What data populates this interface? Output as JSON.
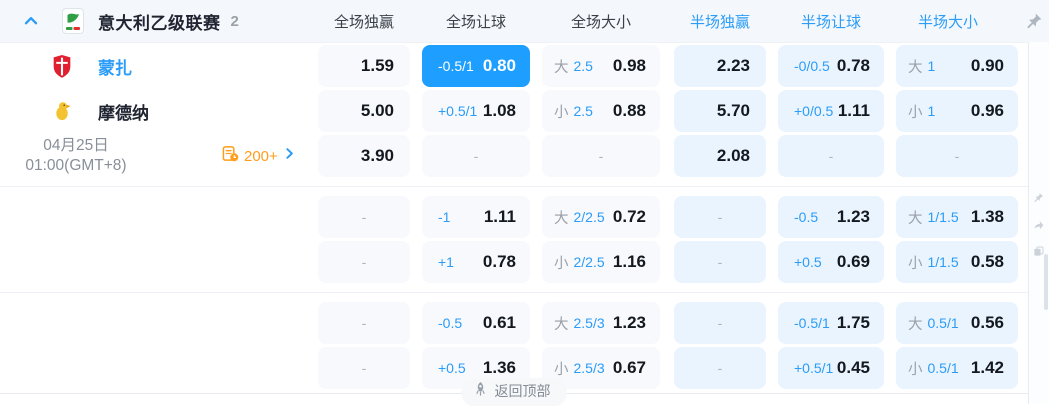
{
  "colors": {
    "accent": "#1e9fff",
    "link_blue": "#2b9cf7",
    "orange": "#ff9e1b"
  },
  "header": {
    "league": "意大利乙级联赛",
    "match_count": "2",
    "columns": [
      {
        "label": "全场独赢",
        "scope": "full"
      },
      {
        "label": "全场让球",
        "scope": "full"
      },
      {
        "label": "全场大小",
        "scope": "full"
      },
      {
        "label": "半场独赢",
        "scope": "half"
      },
      {
        "label": "半场让球",
        "scope": "half"
      },
      {
        "label": "半场大小",
        "scope": "half"
      }
    ]
  },
  "match": {
    "home": {
      "name": "蒙扎"
    },
    "away": {
      "name": "摩德纳"
    },
    "date": "04月25日",
    "time": "01:00(GMT+8)",
    "markets_count": "200+"
  },
  "groups": [
    {
      "rows": [
        {
          "left": "home",
          "cells": [
            {
              "type": "win",
              "odds": "1.59"
            },
            {
              "type": "hcp",
              "line": "-0.5/1",
              "odds": "0.80",
              "highlight": true
            },
            {
              "type": "ou",
              "side": "大",
              "line": "2.5",
              "odds": "0.98"
            },
            {
              "type": "win",
              "odds": "2.23"
            },
            {
              "type": "hcp",
              "line": "-0/0.5",
              "odds": "0.78"
            },
            {
              "type": "ou",
              "side": "大",
              "line": "1",
              "odds": "0.90"
            }
          ]
        },
        {
          "left": "away",
          "cells": [
            {
              "type": "win",
              "odds": "5.00"
            },
            {
              "type": "hcp",
              "line": "+0.5/1",
              "odds": "1.08"
            },
            {
              "type": "ou",
              "side": "小",
              "line": "2.5",
              "odds": "0.88"
            },
            {
              "type": "win",
              "odds": "5.70"
            },
            {
              "type": "hcp",
              "line": "+0/0.5",
              "odds": "1.11"
            },
            {
              "type": "ou",
              "side": "小",
              "line": "1",
              "odds": "0.96"
            }
          ]
        },
        {
          "left": "info",
          "cells": [
            {
              "type": "win",
              "odds": "3.90"
            },
            {
              "type": "dash"
            },
            {
              "type": "dash"
            },
            {
              "type": "win",
              "odds": "2.08"
            },
            {
              "type": "dash"
            },
            {
              "type": "dash"
            }
          ]
        }
      ]
    },
    {
      "rows": [
        {
          "left": "none",
          "cells": [
            {
              "type": "dash"
            },
            {
              "type": "hcp",
              "line": "-1",
              "odds": "1.11"
            },
            {
              "type": "ou",
              "side": "大",
              "line": "2/2.5",
              "odds": "0.72"
            },
            {
              "type": "dash"
            },
            {
              "type": "hcp",
              "line": "-0.5",
              "odds": "1.23"
            },
            {
              "type": "ou",
              "side": "大",
              "line": "1/1.5",
              "odds": "1.38"
            }
          ]
        },
        {
          "left": "none",
          "cells": [
            {
              "type": "dash"
            },
            {
              "type": "hcp",
              "line": "+1",
              "odds": "0.78"
            },
            {
              "type": "ou",
              "side": "小",
              "line": "2/2.5",
              "odds": "1.16"
            },
            {
              "type": "dash"
            },
            {
              "type": "hcp",
              "line": "+0.5",
              "odds": "0.69"
            },
            {
              "type": "ou",
              "side": "小",
              "line": "1/1.5",
              "odds": "0.58"
            }
          ]
        }
      ]
    },
    {
      "rows": [
        {
          "left": "none",
          "cells": [
            {
              "type": "dash"
            },
            {
              "type": "hcp",
              "line": "-0.5",
              "odds": "0.61"
            },
            {
              "type": "ou",
              "side": "大",
              "line": "2.5/3",
              "odds": "1.23"
            },
            {
              "type": "dash"
            },
            {
              "type": "hcp",
              "line": "-0.5/1",
              "odds": "1.75"
            },
            {
              "type": "ou",
              "side": "大",
              "line": "0.5/1",
              "odds": "0.56"
            }
          ]
        },
        {
          "left": "none",
          "cells": [
            {
              "type": "dash"
            },
            {
              "type": "hcp",
              "line": "+0.5",
              "odds": "1.36"
            },
            {
              "type": "ou",
              "side": "小",
              "line": "2.5/3",
              "odds": "0.67"
            },
            {
              "type": "dash"
            },
            {
              "type": "hcp",
              "line": "+0.5/1",
              "odds": "0.45"
            },
            {
              "type": "ou",
              "side": "小",
              "line": "0.5/1",
              "odds": "1.42"
            }
          ]
        }
      ]
    }
  ],
  "footer": {
    "back_to_top": "返回顶部"
  }
}
